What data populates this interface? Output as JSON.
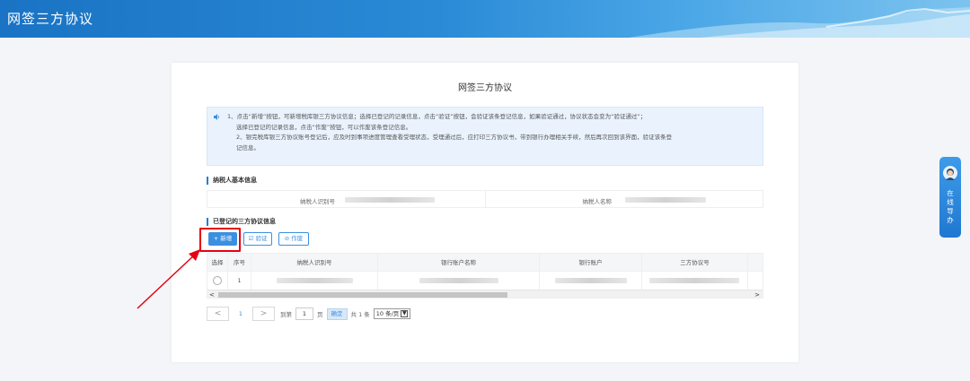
{
  "header": {
    "title": "网签三方协议"
  },
  "card": {
    "title": "网签三方协议"
  },
  "tips": {
    "line1a": "1、点击“新增”按钮，可新增税库银三方协议信息；选择已登记的记录信息，点击“验证”按钮，会验证该条登记信息，如果验证通过，协议状态会变为“验证通过”；",
    "line1b": "选择已登记的记录信息，点击“作废”按钮，可以作废该条登记信息。",
    "line2a": "2、银完税库银三方协议账号登记后，应及时到事项进度管理查看受理状态，受理通过后，应打印三方协议书，带到银行办理相关手续，然后再次回到该界面，验证该条登",
    "line2b": "记信息。"
  },
  "basic_info": {
    "title": "纳税人基本信息",
    "id_label": "纳税人识别号",
    "name_label": "纳税人名称"
  },
  "registered": {
    "title": "已登记的三方协议信息",
    "add_label": "+ 新增",
    "verify_label": "☑ 验证",
    "void_label": "⊘ 作废"
  },
  "table": {
    "columns": [
      "选择",
      "序号",
      "纳税人识别号",
      "银行账户名称",
      "银行账户",
      "三方协议号"
    ],
    "rows": [
      {
        "index": "1"
      }
    ]
  },
  "pager": {
    "prev": "<",
    "page": "1",
    "next": ">",
    "goto_label": "到第",
    "goto_value": "1",
    "page_unit": "页",
    "go_label": "确定",
    "total": "共 1 条",
    "page_size": "10 条/页"
  },
  "side_nav": {
    "label": "在线导办"
  },
  "colors": {
    "accent": "#3b8fe0",
    "highlight": "#e60012"
  }
}
